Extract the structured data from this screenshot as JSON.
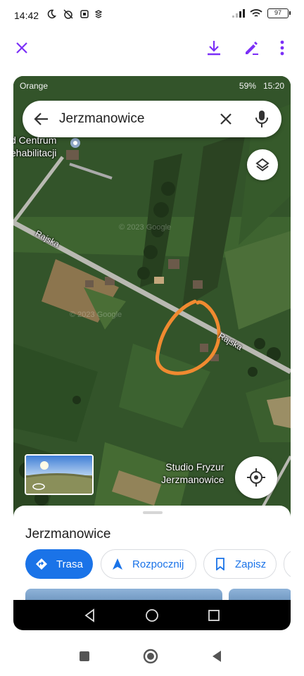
{
  "status_bar": {
    "time": "14:42",
    "battery": "97"
  },
  "inner_status_bar": {
    "carrier": "Orange",
    "battery_pct": "59%",
    "time": "15:20"
  },
  "search": {
    "query": "Jerzmanowice"
  },
  "map": {
    "place_label_top": [
      "d Centrum",
      "ehabilitacji"
    ],
    "road_label_1": "Rajska",
    "road_label_2": "Rajska",
    "place_label_bottom": [
      "Studio Fryzur",
      "Jerzmanowice"
    ],
    "watermark_1": "© 2023 Google",
    "watermark_2": "© 2023 Google"
  },
  "sheet": {
    "title": "Jerzmanowice",
    "chips": {
      "route": "Trasa",
      "start": "Rozpocznij",
      "save": "Zapisz"
    }
  },
  "colors": {
    "accent": "#1a73e8",
    "viewer_purple": "#7b2ff7",
    "annotation": "#f08a30"
  }
}
